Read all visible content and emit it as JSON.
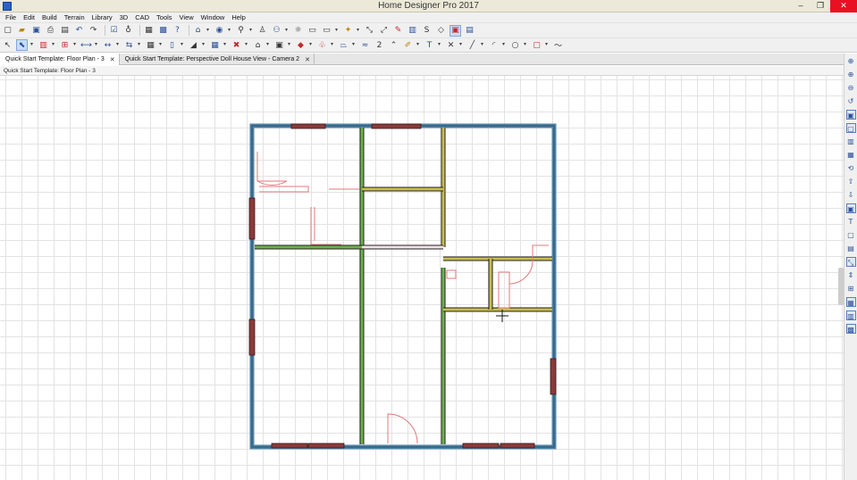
{
  "window": {
    "title": "Home Designer Pro 2017",
    "min": "–",
    "restore": "❐",
    "close": "✕"
  },
  "menu": [
    "File",
    "Edit",
    "Build",
    "Terrain",
    "Library",
    "3D",
    "CAD",
    "Tools",
    "View",
    "Window",
    "Help"
  ],
  "toolbar1": [
    {
      "name": "new-file-icon",
      "glyph": "▢",
      "c": "k"
    },
    {
      "name": "open-folder-icon",
      "glyph": "▰",
      "c": "y"
    },
    {
      "name": "save-icon",
      "glyph": "▣",
      "c": ""
    },
    {
      "name": "print-icon",
      "glyph": "⎙",
      "c": "k"
    },
    {
      "name": "print-preview-icon",
      "glyph": "▤",
      "c": "k"
    },
    {
      "name": "undo-icon",
      "glyph": "↶",
      "c": ""
    },
    {
      "name": "redo-icon",
      "glyph": "↷",
      "c": "k"
    },
    {
      "sep": true
    },
    {
      "name": "check-icon",
      "glyph": "☑",
      "c": ""
    },
    {
      "name": "lightbulb-icon",
      "glyph": "♁",
      "c": "k"
    },
    {
      "sep": true
    },
    {
      "name": "layout-icon",
      "glyph": "▦",
      "c": "k"
    },
    {
      "name": "save-view-icon",
      "glyph": "▩",
      "c": ""
    },
    {
      "name": "help-icon",
      "glyph": "?",
      "c": ""
    },
    {
      "sep": true
    },
    {
      "name": "home-view-icon",
      "glyph": "⌂",
      "c": "",
      "dd": true
    },
    {
      "name": "camera-icon",
      "glyph": "◉",
      "c": "",
      "dd": true
    },
    {
      "name": "walkthrough-icon",
      "glyph": "⚲",
      "c": "k",
      "dd": true
    },
    {
      "name": "walk-icon",
      "glyph": "♙",
      "c": "k"
    },
    {
      "name": "binoculars-icon",
      "glyph": "⚇",
      "c": "",
      "dd": true
    },
    {
      "name": "light-off-icon",
      "glyph": "☼",
      "c": "k"
    },
    {
      "name": "rectangle-icon",
      "glyph": "▭",
      "c": "k"
    },
    {
      "name": "display-icon",
      "glyph": "▭",
      "c": "k",
      "dd": true
    },
    {
      "name": "materials-icon",
      "glyph": "✦",
      "c": "y",
      "dd": true
    },
    {
      "name": "resize-icon",
      "glyph": "⤡",
      "c": "k"
    },
    {
      "name": "expand-icon",
      "glyph": "⤢",
      "c": "k"
    },
    {
      "name": "paint-icon",
      "glyph": "✎",
      "c": "r"
    },
    {
      "name": "library-icon",
      "glyph": "▥",
      "c": ""
    },
    {
      "name": "text-style-icon",
      "glyph": "S",
      "c": "k"
    },
    {
      "name": "eraser-icon",
      "glyph": "◇",
      "c": "k"
    },
    {
      "name": "active-layer-icon",
      "glyph": "▣",
      "c": "r",
      "sel": true
    },
    {
      "name": "layer-display-icon",
      "glyph": "▤",
      "c": ""
    }
  ],
  "toolbar2": [
    {
      "name": "select-objects-icon",
      "glyph": "↖",
      "c": "k"
    },
    {
      "name": "select-edit-icon",
      "glyph": "⬉",
      "c": "",
      "dd": true,
      "sel": true
    },
    {
      "name": "wall-tool-icon",
      "glyph": "▥",
      "c": "r",
      "dd": true
    },
    {
      "name": "room-tool-icon",
      "glyph": "⊞",
      "c": "r",
      "dd": true
    },
    {
      "name": "dimension-tool-icon",
      "glyph": "⟷",
      "c": "",
      "dd": true
    },
    {
      "name": "line-dimension-icon",
      "glyph": "↔",
      "c": "",
      "dd": true
    },
    {
      "name": "arrow-icon",
      "glyph": "⇆",
      "c": "",
      "dd": true
    },
    {
      "name": "cabinet-tool-icon",
      "glyph": "▦",
      "c": "k",
      "dd": true
    },
    {
      "name": "door-tool-icon",
      "glyph": "▯",
      "c": "",
      "dd": true
    },
    {
      "name": "stair-tool-icon",
      "glyph": "◢",
      "c": "k",
      "dd": true
    },
    {
      "name": "window-tool-icon",
      "glyph": "▦",
      "c": "",
      "dd": true
    },
    {
      "name": "fixture-icon",
      "glyph": "✖",
      "c": "r",
      "dd": true
    },
    {
      "name": "roof-tool-icon",
      "glyph": "⌂",
      "c": "k",
      "dd": true
    },
    {
      "name": "framing-icon",
      "glyph": "▣",
      "c": "k",
      "dd": true
    },
    {
      "name": "terrain-tool-icon",
      "glyph": "◆",
      "c": "r",
      "dd": true
    },
    {
      "name": "deck-tool-icon",
      "glyph": "♧",
      "c": "r",
      "dd": true
    },
    {
      "name": "shape-icon",
      "glyph": "⏢",
      "c": "",
      "dd": true
    },
    {
      "name": "fill-icon",
      "glyph": "≈",
      "c": ""
    },
    {
      "name": "text-icon",
      "glyph": "2",
      "c": "k"
    },
    {
      "name": "elevation-icon",
      "glyph": "⌃",
      "c": "k"
    },
    {
      "name": "measure-icon",
      "glyph": "✐",
      "c": "y",
      "dd": true
    },
    {
      "name": "text-tool-icon",
      "glyph": "T",
      "c": "",
      "dd": true
    },
    {
      "name": "cad-cross-icon",
      "glyph": "✕",
      "c": "k",
      "dd": true
    },
    {
      "name": "line-tool-icon",
      "glyph": "╱",
      "c": "k",
      "dd": true
    },
    {
      "name": "arc-tool-icon",
      "glyph": "◜",
      "c": "k",
      "dd": true
    },
    {
      "name": "circle-tool-icon",
      "glyph": "○",
      "c": "k",
      "dd": true
    },
    {
      "name": "box-tool-icon",
      "glyph": "▢",
      "c": "r",
      "dd": true
    },
    {
      "name": "spline-tool-icon",
      "glyph": "〜",
      "c": "k"
    }
  ],
  "tabs": [
    {
      "label": "Quick Start Template: Floor Plan - 3",
      "active": true
    },
    {
      "label": "Quick Start Template: Perspective Doll House View - Camera 2",
      "active": false
    }
  ],
  "tab_close": "✕",
  "doc_header": "Quick Start Template: Floor Plan - 3",
  "right_toolbar": [
    {
      "name": "zoom-icon",
      "glyph": "⊕"
    },
    {
      "name": "zoom-in-icon",
      "glyph": "⊕"
    },
    {
      "name": "zoom-out-icon",
      "glyph": "⊖"
    },
    {
      "name": "undo-zoom-icon",
      "glyph": "↺"
    },
    {
      "name": "fill-window-icon",
      "glyph": "▣",
      "boxed": true
    },
    {
      "name": "fill-window-building-icon",
      "glyph": "▢",
      "boxed": true
    },
    {
      "name": "pan-window-icon",
      "glyph": "▥"
    },
    {
      "name": "swap-view-icon",
      "glyph": "▦"
    },
    {
      "name": "refresh-icon",
      "glyph": "⟲"
    },
    {
      "name": "up-floor-icon",
      "glyph": "⇧"
    },
    {
      "name": "down-floor-icon",
      "glyph": "⇩"
    },
    {
      "name": "view-icon",
      "glyph": "▣",
      "boxed": true
    },
    {
      "name": "text-icon",
      "glyph": "T"
    },
    {
      "name": "print-area-icon",
      "glyph": "▢"
    },
    {
      "name": "page-icon",
      "glyph": "▤"
    },
    {
      "name": "resize-icon",
      "glyph": "⤡",
      "boxed": true
    },
    {
      "name": "scroll-icon",
      "glyph": "⇕"
    },
    {
      "name": "plan-icon",
      "glyph": "⊞"
    },
    {
      "name": "elevation-view-icon",
      "glyph": "▦",
      "boxed": true
    },
    {
      "name": "section-icon",
      "glyph": "▥",
      "boxed": true
    },
    {
      "name": "grid-icon",
      "glyph": "▩",
      "boxed": true
    }
  ],
  "plan": {
    "exterior_wall_color": "#4f84a9",
    "interior_wall_green": "#6cb24c",
    "interior_wall_dark": "#3a3a22",
    "interior_wall_yellow": "#c9bd4f",
    "window_color": "#8a3a3a",
    "door_color": "#e07a7a"
  }
}
